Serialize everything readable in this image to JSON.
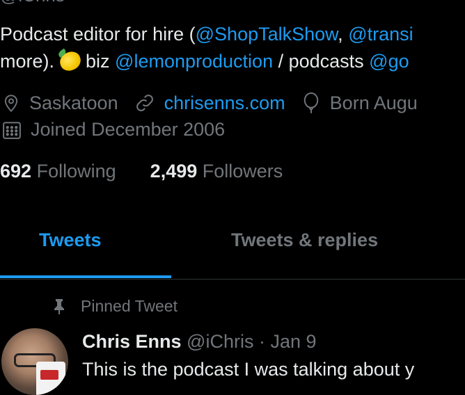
{
  "profile": {
    "handle_top": "@iChris",
    "bio": {
      "line1_pre": "Podcast editor for hire (",
      "line1_link1": "@ShopTalkShow",
      "line1_sep": ", ",
      "line1_link2": "@transi",
      "line2_pre": "more). ",
      "line2_mid": " biz ",
      "line2_link1": "@lemonproduction",
      "line2_mid2": " / podcasts ",
      "line2_link2": "@go"
    },
    "location": "Saskatoon",
    "website": "chrisenns.com",
    "birth": "Born Augu",
    "joined": "Joined December 2006",
    "following_count": "692",
    "following_label": "Following",
    "followers_count": "2,499",
    "followers_label": "Followers"
  },
  "tabs": [
    {
      "label": "Tweets",
      "active": true
    },
    {
      "label": "Tweets & replies",
      "active": false
    }
  ],
  "pinned_label": "Pinned Tweet",
  "tweet": {
    "name": "Chris Enns",
    "handle": "@iChris",
    "dot": "·",
    "date": "Jan 9",
    "text": "This is the podcast I was talking about y"
  },
  "icons": {
    "location": "map-pin-icon",
    "website": "link-icon",
    "birth": "balloon-icon",
    "joined": "calendar-icon",
    "pinned": "pin-icon"
  },
  "colors": {
    "accent": "#1d9bf0",
    "background": "#000000",
    "muted": "#71767b"
  }
}
